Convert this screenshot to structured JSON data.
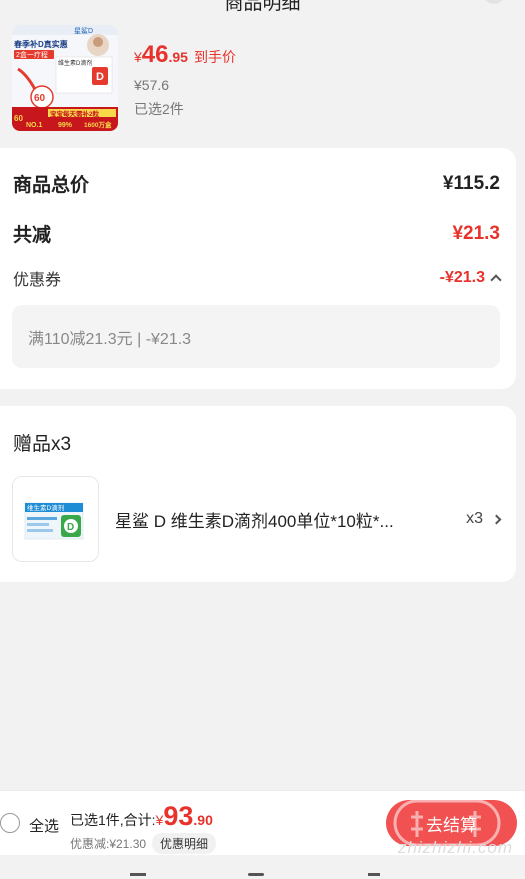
{
  "header": {
    "title": "商品明细"
  },
  "product": {
    "price_symbol": "¥",
    "price_int": "46",
    "price_dec": ".95",
    "price_tag": "到手价",
    "original_price": "¥57.6",
    "selected_count": "已选2件",
    "thumb_texts": {
      "brand": "星鲨D",
      "headline": "春季补D真实惠",
      "sub": "2盒一疗程",
      "pkg": "维生素D滴剂",
      "badge_num": "60",
      "banner": "宝宝每天需补2粒",
      "no1": "NO.1",
      "pct": "99%",
      "sales": "1600万盒"
    }
  },
  "summary": {
    "total_label": "商品总价",
    "total_value": "¥115.2",
    "reduced_label": "共减",
    "reduced_value": "¥21.3",
    "coupon_label": "优惠券",
    "coupon_value": "-¥21.3",
    "coupon_detail": "满110减21.3元 | -¥21.3"
  },
  "gifts": {
    "title": "赠品x3",
    "items": [
      {
        "name": "星鲨 D 维生素D滴剂400单位*10粒*...",
        "qty": "x3",
        "thumb_label": "维生素D滴剂"
      }
    ]
  },
  "bottom": {
    "select_all": "全选",
    "total_prefix": "已选1件,合计:",
    "total_symbol": "¥",
    "total_int": "93",
    "total_dec": ".90",
    "discount_text": "优惠减:¥21.30",
    "discount_button": "优惠明细",
    "checkout_label": "去结算",
    "watermark": "zhizhizhi.com"
  },
  "colors": {
    "accent": "#e8322c",
    "checkout": "#f15151",
    "background": "#f2f2f2"
  }
}
